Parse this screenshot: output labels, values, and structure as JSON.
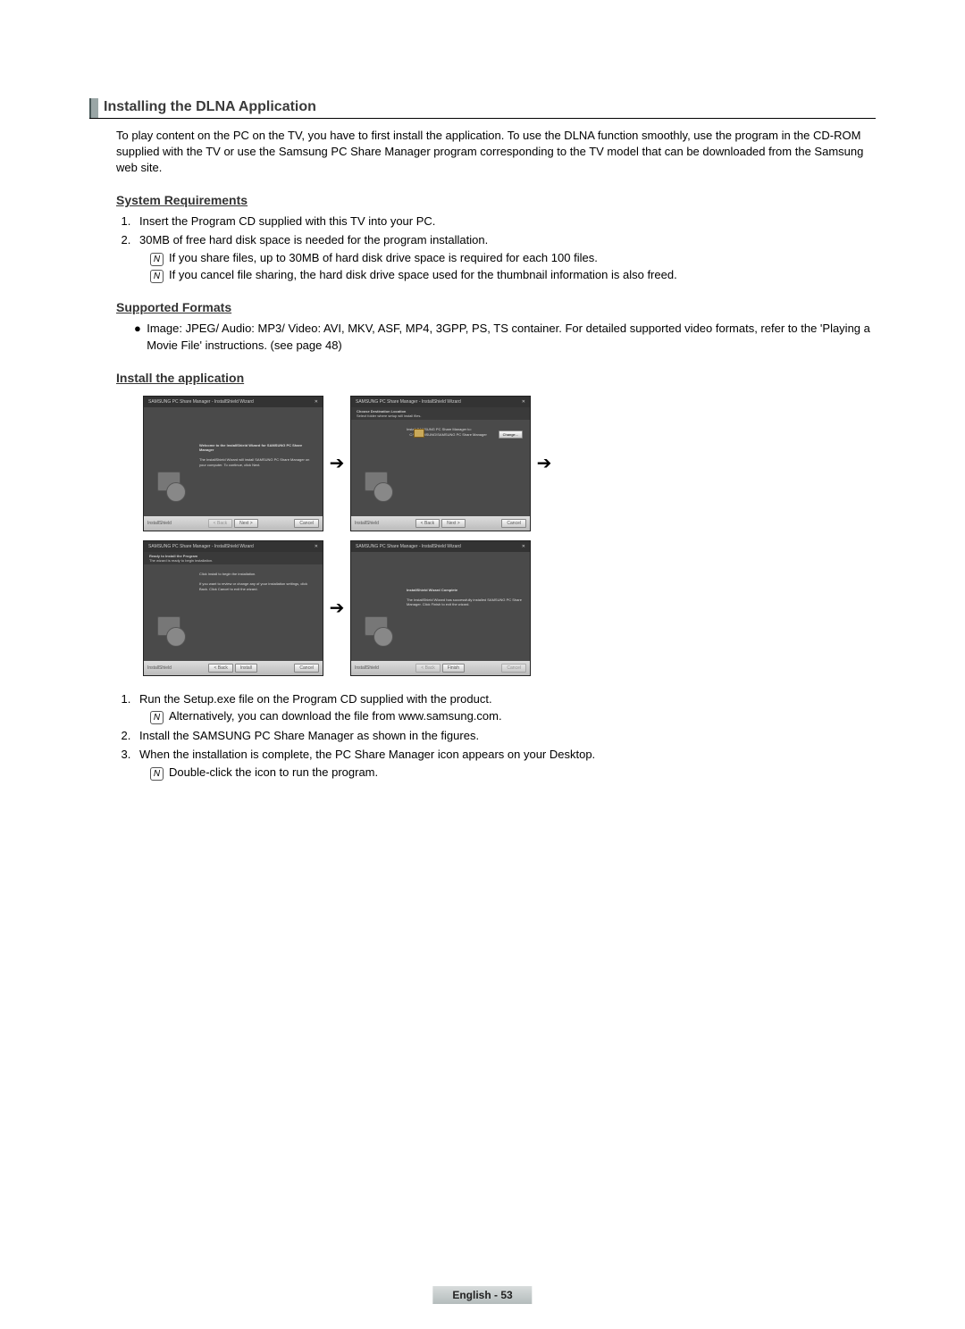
{
  "header": {
    "title": "Installing the DLNA Application"
  },
  "intro": "To play content on the PC on the TV, you have to first install the application. To use the DLNA function smoothly, use the program in the CD-ROM supplied with the TV or use the Samsung PC Share Manager program corresponding to the TV model that can be downloaded from the Samsung web site.",
  "system_requirements": {
    "heading": "System Requirements",
    "items": [
      "Insert the Program CD supplied with this TV into your PC.",
      "30MB of free hard disk space is needed for the program  installation."
    ],
    "notes": [
      "If you share files, up to 30MB of hard disk drive space is required for each 100 files.",
      "If you cancel file sharing, the hard disk drive space used for the thumbnail information is also freed."
    ]
  },
  "supported_formats": {
    "heading": "Supported Formats",
    "text": "Image: JPEG/ Audio: MP3/ Video: AVI, MKV, ASF, MP4, 3GPP, PS, TS container. For detailed supported video formats, refer to the 'Playing a Movie File' instructions. (see page 48)"
  },
  "install": {
    "heading": "Install the application",
    "steps": [
      "Run the Setup.exe file on the Program CD supplied with the product.",
      "Install the SAMSUNG PC Share Manager as shown in the figures.",
      "When the installation is complete, the PC Share Manager icon appears on your Desktop."
    ],
    "step1_note": "Alternatively, you can download the file from www.samsung.com.",
    "step3_note": "Double-click the icon to run the program."
  },
  "wizard": {
    "titlebar": "SAMSUNG PC Share Manager - InstallShield Wizard",
    "screen1_h": "Welcome to the InstallShield Wizard for SAMSUNG PC Share Manager",
    "screen1_t": "The InstallShield Wizard will install SAMSUNG PC Share Manager on your computer. To continue, click Next.",
    "screen2_h1": "Choose Destination Location",
    "screen2_h2": "Select folder where setup will install files.",
    "screen2_t": "Install SAMSUNG PC Share Manager to:\n   C:\\...\\SAMSUNG\\SAMSUNG PC Share Manager",
    "screen3_h1": "Ready to Install the Program",
    "screen3_h2": "The wizard is ready to begin installation.",
    "screen3_t1": "Click Install to begin the installation.",
    "screen3_t2": "If you want to review or change any of your installation settings, click Back. Click Cancel to exit the wizard.",
    "screen4_h": "InstallShield Wizard Complete",
    "screen4_t": "The InstallShield Wizard has successfully installed SAMSUNG PC Share Manager. Click Finish to exit the wizard.",
    "btn_back": "< Back",
    "btn_next": "Next >",
    "btn_install": "Install",
    "btn_finish": "Finish",
    "btn_cancel": "Cancel",
    "btn_change": "Change...",
    "installshield": "InstallShield"
  },
  "footer": "English - 53"
}
